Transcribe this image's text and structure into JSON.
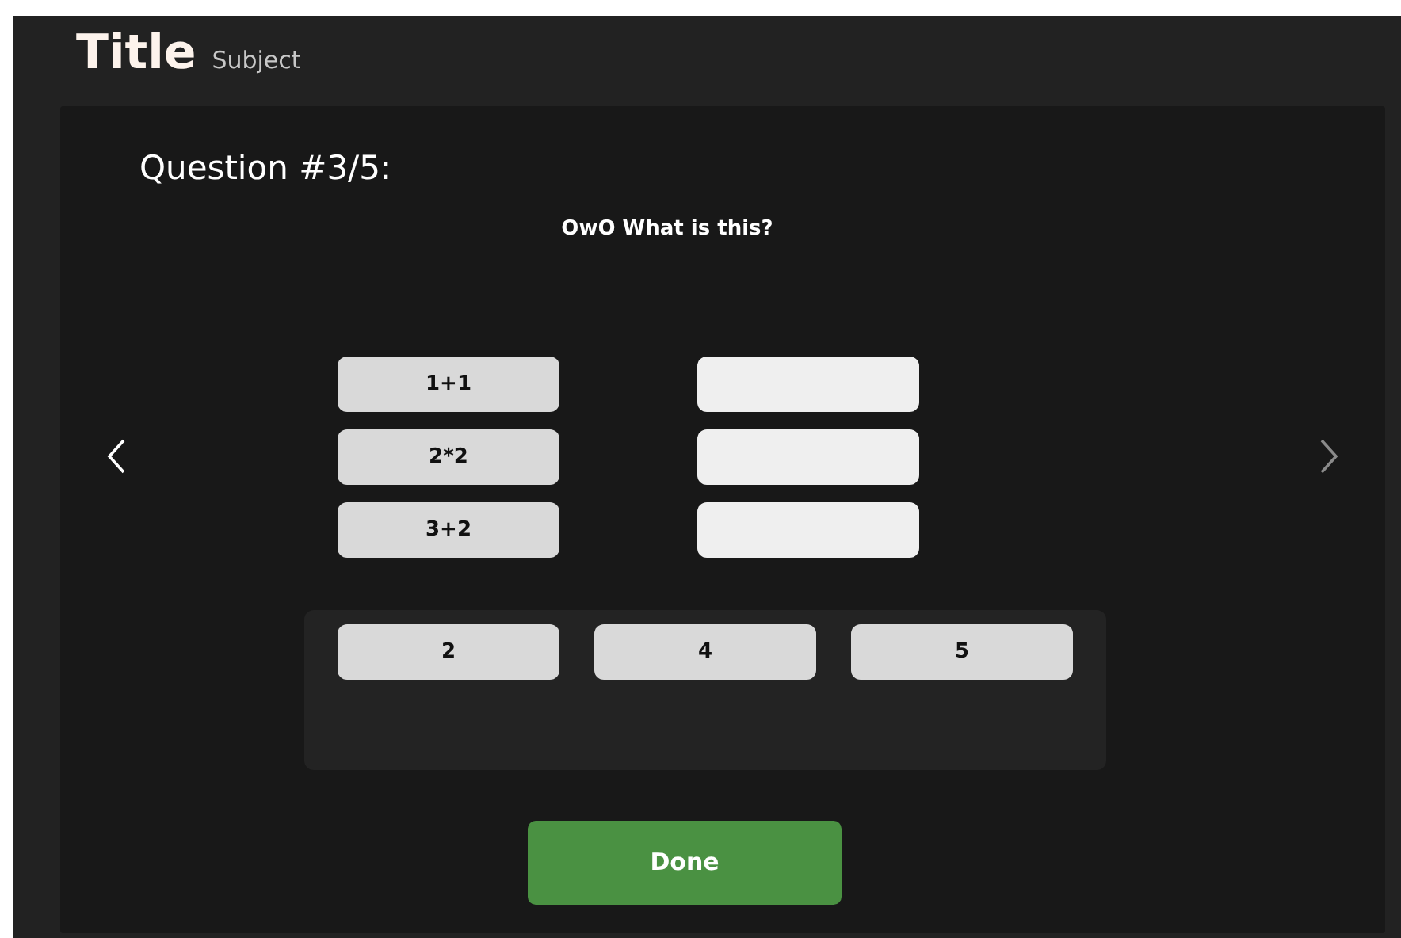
{
  "header": {
    "title": "Title",
    "subject": "Subject"
  },
  "question": {
    "heading": "Question #3/5:",
    "prompt": "OwO What is this?"
  },
  "navigation": {
    "previous": {
      "disabled": false
    },
    "next": {
      "disabled": true
    }
  },
  "terms": [
    {
      "label": "1+1"
    },
    {
      "label": "2*2"
    },
    {
      "label": "3+2"
    }
  ],
  "answer_bank": [
    {
      "label": "2"
    },
    {
      "label": "4"
    },
    {
      "label": "5"
    }
  ],
  "done_button": {
    "label": "Done"
  }
}
